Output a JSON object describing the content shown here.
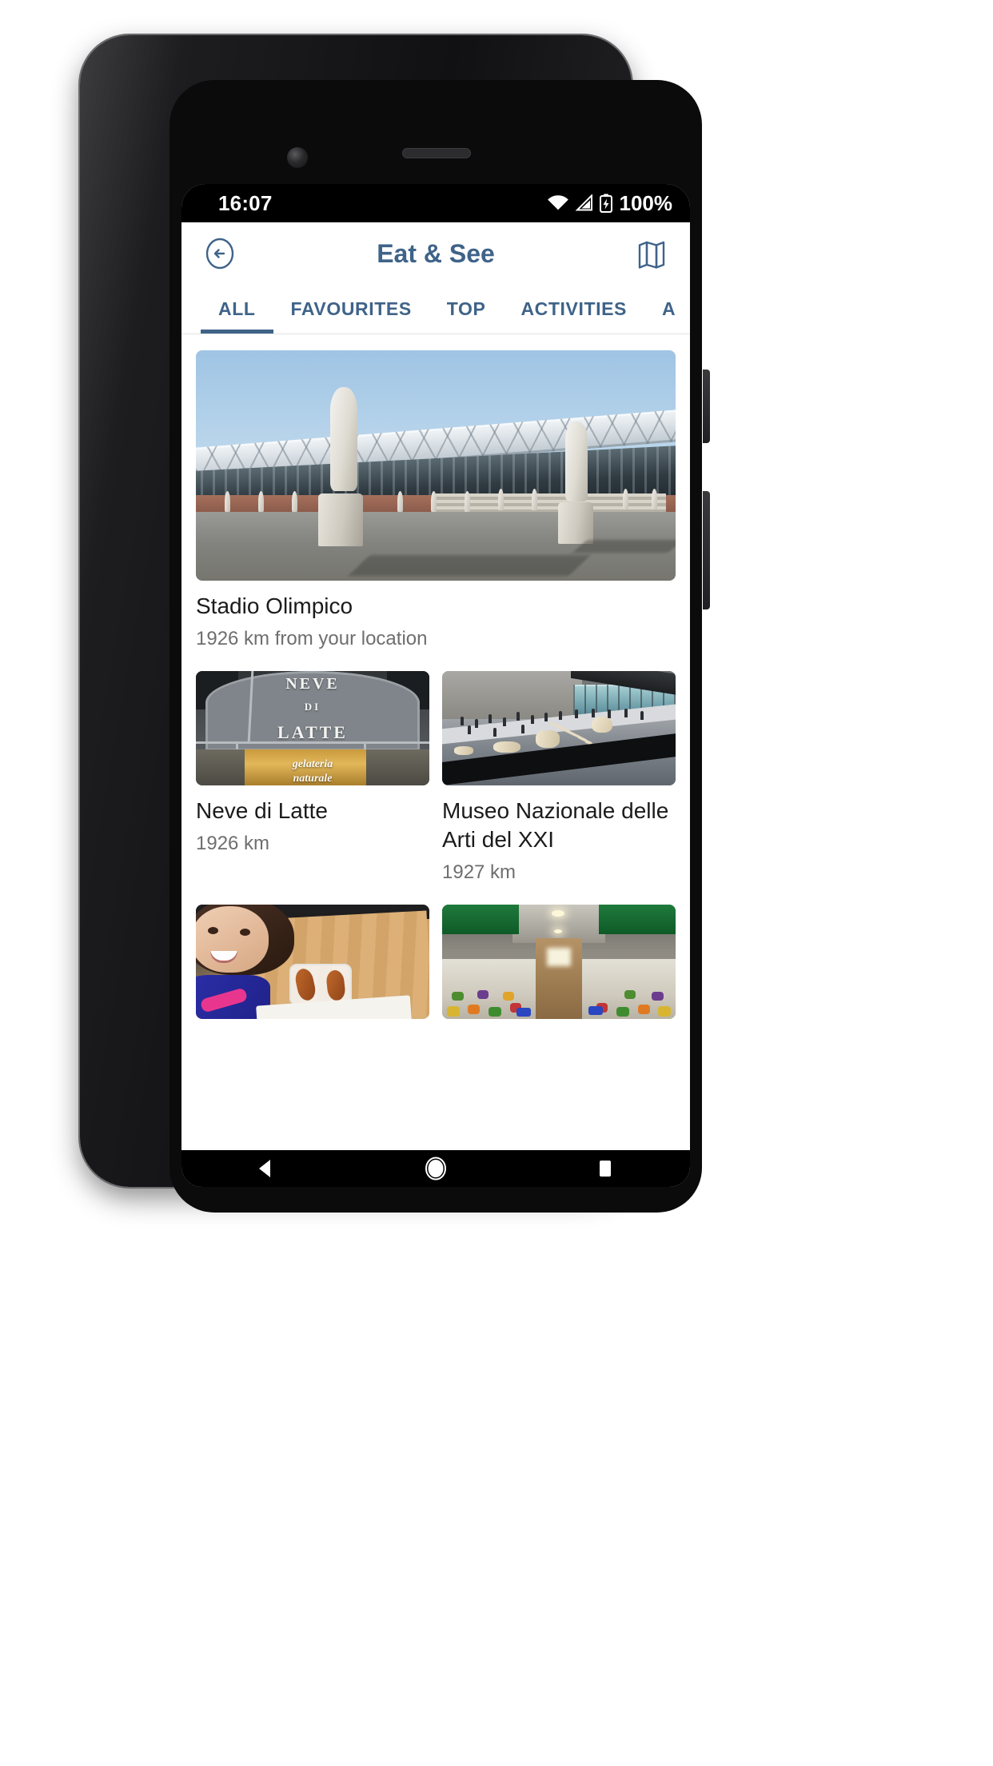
{
  "status_bar": {
    "time": "16:07",
    "battery_text": "100%",
    "icons": [
      "wifi-icon",
      "cellular-signal-icon",
      "battery-charging-icon"
    ]
  },
  "app_bar": {
    "title": "Eat & See",
    "back_icon": "back-arrow-circle-icon",
    "map_icon": "map-icon"
  },
  "tabs": [
    {
      "label": "ALL",
      "active": true
    },
    {
      "label": "FAVOURITES",
      "active": false
    },
    {
      "label": "TOP",
      "active": false
    },
    {
      "label": "ACTIVITIES",
      "active": false
    },
    {
      "label": "A",
      "active": false
    }
  ],
  "list": {
    "hero": {
      "title": "Stadio Olimpico",
      "subtitle": "1926 km from your location",
      "image_alt": "Statues in front of Stadio Olimpico stadium"
    },
    "grid": [
      {
        "title": "Neve di Latte",
        "subtitle": "1926 km",
        "image_alt": "Neve di Latte gelateria storefront sign"
      },
      {
        "title": "Museo Nazionale delle Arti del XXI",
        "subtitle": "1927 km",
        "image_alt": "MAXXI museum plaza with giant skeleton sculpture"
      },
      {
        "title": "",
        "subtitle": "",
        "image_alt": "Girl smiling at table with supplì in a container"
      },
      {
        "title": "",
        "subtitle": "",
        "image_alt": "Indoor food market aisle with fruit and vegetable stalls"
      }
    ]
  },
  "nav_bar": {
    "back": "nav-back-icon",
    "home": "nav-home-icon",
    "recents": "nav-recents-icon"
  },
  "colors": {
    "accent": "#3f6389",
    "title_text": "#1b1b1b",
    "subtitle_text": "#6e6e6e",
    "status_bar_bg": "#000000",
    "screen_bg": "#ffffff"
  }
}
